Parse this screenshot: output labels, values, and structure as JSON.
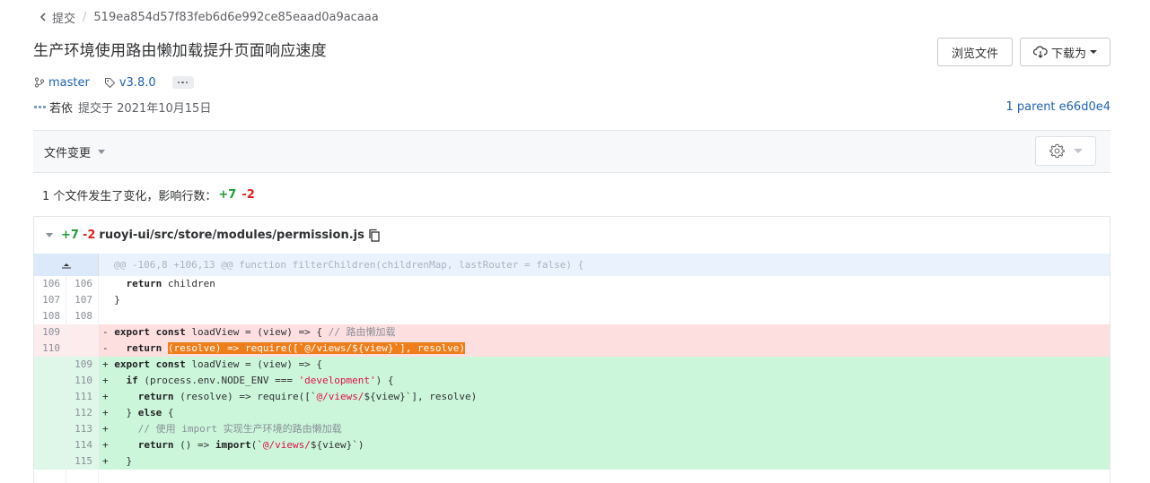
{
  "breadcrumb": {
    "back_label": "提交",
    "sha": "519ea854d57f83feb6d6e992ce85eaad0a9acaaa"
  },
  "commit": {
    "title": "生产环境使用路由懒加载提升页面响应速度",
    "branch": "master",
    "tag": "v3.8.0",
    "author": "若依",
    "committed_text": "提交于 2021年10月15日",
    "parent_text": "1 parent e66d0e4"
  },
  "actions": {
    "browse_label": "浏览文件",
    "download_label": "下载为"
  },
  "files_bar": {
    "label": "文件变更"
  },
  "summary": {
    "text": "1 个文件发生了变化，影响行数：",
    "additions": "+7",
    "deletions": "-2"
  },
  "file": {
    "additions": "+7",
    "deletions": "-2",
    "path": "ruoyi-ui/src/store/modules/permission.js"
  },
  "diff": {
    "hunk": "@@ -106,8 +106,13 @@ function filterChildren(childrenMap, lastRouter = false) {",
    "lines": [
      {
        "type": "ctx",
        "old": "106",
        "new": "106",
        "prefix": " ",
        "parts": [
          {
            "t": "  "
          },
          {
            "t": "return",
            "c": "kw"
          },
          {
            "t": " children"
          }
        ]
      },
      {
        "type": "ctx",
        "old": "107",
        "new": "107",
        "prefix": " ",
        "parts": [
          {
            "t": "}"
          }
        ]
      },
      {
        "type": "ctx",
        "old": "108",
        "new": "108",
        "prefix": " ",
        "parts": [
          {
            "t": ""
          }
        ]
      },
      {
        "type": "del",
        "old": "109",
        "new": "",
        "prefix": "-",
        "parts": [
          {
            "t": "export const",
            "c": "kw"
          },
          {
            "t": " loadView = (view) => { "
          },
          {
            "t": "// 路由懒加载",
            "c": "cm"
          }
        ]
      },
      {
        "type": "del",
        "old": "110",
        "new": "",
        "prefix": "-",
        "parts": [
          {
            "t": "  "
          },
          {
            "t": "return",
            "c": "kw"
          },
          {
            "t": " "
          },
          {
            "t": "(resolve) => require([`@/views/${view}`], resolve)",
            "c": "hl"
          }
        ]
      },
      {
        "type": "add",
        "old": "",
        "new": "109",
        "prefix": "+",
        "parts": [
          {
            "t": "export const",
            "c": "kw"
          },
          {
            "t": " loadView = (view) => {"
          }
        ]
      },
      {
        "type": "add",
        "old": "",
        "new": "110",
        "prefix": "+",
        "parts": [
          {
            "t": "  "
          },
          {
            "t": "if",
            "c": "kw"
          },
          {
            "t": " (process.env.NODE_ENV === "
          },
          {
            "t": "'development'",
            "c": "str"
          },
          {
            "t": ") {"
          }
        ]
      },
      {
        "type": "add",
        "old": "",
        "new": "111",
        "prefix": "+",
        "parts": [
          {
            "t": "    "
          },
          {
            "t": "return",
            "c": "kw"
          },
          {
            "t": " (resolve) => require([`"
          },
          {
            "t": "@/views/",
            "c": "str"
          },
          {
            "t": "${view}`], resolve)"
          }
        ]
      },
      {
        "type": "add",
        "old": "",
        "new": "112",
        "prefix": "+",
        "parts": [
          {
            "t": "  } "
          },
          {
            "t": "else",
            "c": "kw"
          },
          {
            "t": " {"
          }
        ]
      },
      {
        "type": "add",
        "old": "",
        "new": "113",
        "prefix": "+",
        "parts": [
          {
            "t": "    "
          },
          {
            "t": "// 使用 import 实现生产环境的路由懒加载",
            "c": "cm"
          }
        ]
      },
      {
        "type": "add",
        "old": "",
        "new": "114",
        "prefix": "+",
        "parts": [
          {
            "t": "    "
          },
          {
            "t": "return",
            "c": "kw"
          },
          {
            "t": " () => "
          },
          {
            "t": "import",
            "c": "kw"
          },
          {
            "t": "(`"
          },
          {
            "t": "@/views/",
            "c": "str"
          },
          {
            "t": "${view}`)"
          }
        ]
      },
      {
        "type": "add",
        "old": "",
        "new": "115",
        "prefix": "+",
        "parts": [
          {
            "t": "  }"
          }
        ]
      },
      {
        "type": "blank",
        "old": "",
        "new": "",
        "prefix": "",
        "parts": [
          {
            "t": ""
          }
        ]
      }
    ]
  },
  "colors": {
    "link": "#1e63b3",
    "add": "#1a9e37",
    "del": "#e02020",
    "highlight": "#ef7d1a"
  }
}
